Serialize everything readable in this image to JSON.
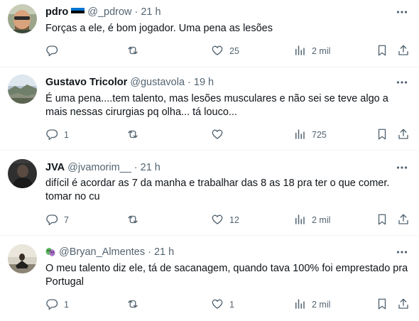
{
  "tweets": [
    {
      "name": "pdro",
      "flag_colors": [
        "#0072CE",
        "#000000",
        "#FFFFFF"
      ],
      "handle": "@_pdrow",
      "dot": "·",
      "time": "21 h",
      "text": "Forças a ele, é bom jogador. Uma pena as lesões",
      "replies": "",
      "retweets": "",
      "likes": "25",
      "views": "2 mil"
    },
    {
      "name": "Gustavo Tricolor",
      "handle": "@gustavola",
      "dot": "·",
      "time": "19 h",
      "text": "É uma pena....tem talento, mas lesões musculares e não sei se teve algo a mais nessas cirurgias pq olha... tá louco...",
      "replies": "1",
      "retweets": "",
      "likes": "",
      "views": "725"
    },
    {
      "name": "JVA",
      "handle": "@jvamorim__",
      "dot": "·",
      "time": "21 h",
      "text": "difícil é acordar as 7 da manha e trabalhar das 8 as 18 pra ter o que comer. tomar no cu",
      "replies": "7",
      "retweets": "",
      "likes": "12",
      "views": "2 mil"
    },
    {
      "name": "",
      "name_emoji": "green-and-purple-masks",
      "handle": "@Bryan_Almentes",
      "dot": "·",
      "time": "21 h",
      "text": "O meu talento diz ele, tá de sacanagem, quando tava 100% foi emprestado pra Portugal",
      "replies": "1",
      "retweets": "",
      "likes": "1",
      "views": "2 mil"
    }
  ],
  "icons": {
    "reply": "reply-icon",
    "retweet": "retweet-icon",
    "like": "heart-icon",
    "views": "views-icon",
    "bookmark": "bookmark-icon",
    "share": "share-icon",
    "more": "more-icon"
  },
  "colors": {
    "text": "#0f1419",
    "secondary": "#536471",
    "divider": "#eff3f4"
  }
}
